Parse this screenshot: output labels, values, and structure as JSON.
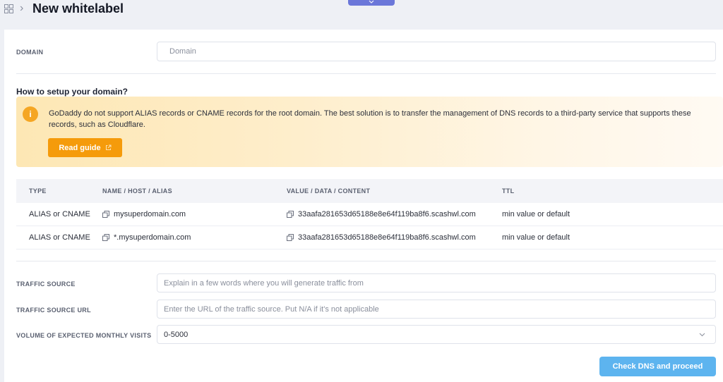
{
  "header": {
    "breadcrumb_separator": "›",
    "title": "New whitelabel"
  },
  "domain": {
    "label": "DOMAIN",
    "placeholder": "Domain"
  },
  "setup": {
    "title": "How to setup your domain?",
    "alert_icon": "i",
    "alert_text": "GoDaddy do not support ALIAS records or CNAME records for the root domain. The best solution is to transfer the management of DNS records to a third-party service that supports these records, such as Cloudflare.",
    "read_guide_label": "Read guide"
  },
  "dns_table": {
    "headers": [
      "TYPE",
      "NAME / HOST / ALIAS",
      "VALUE / DATA / CONTENT",
      "TTL"
    ],
    "rows": [
      {
        "type": "ALIAS or CNAME",
        "name": "mysuperdomain.com",
        "value": "33aafa281653d65188e8e64f119ba8f6.scashwl.com",
        "ttl": "min value or default"
      },
      {
        "type": "ALIAS or CNAME",
        "name": "*.mysuperdomain.com",
        "value": "33aafa281653d65188e8e64f119ba8f6.scashwl.com",
        "ttl": "min value or default"
      }
    ]
  },
  "traffic": {
    "source_label": "TRAFFIC SOURCE",
    "source_placeholder": "Explain in a few words where you will generate traffic from",
    "url_label": "TRAFFIC SOURCE URL",
    "url_placeholder": "Enter the URL of the traffic source. Put N/A if it's not applicable",
    "volume_label": "VOLUME OF EXPECTED MONTHLY VISITS",
    "volume_value": "0-5000"
  },
  "actions": {
    "submit_label": "Check DNS and proceed"
  },
  "colors": {
    "accent": "#5db4ef",
    "warning": "#f59b0b",
    "tab": "#6b77d9"
  }
}
